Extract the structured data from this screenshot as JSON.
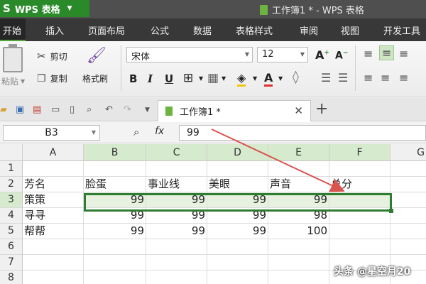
{
  "titlebar": {
    "app_name": "WPS 表格",
    "window_title": "工作簿1 * - WPS 表格"
  },
  "menu": [
    "开始",
    "插入",
    "页面布局",
    "公式",
    "数据",
    "表格样式",
    "审阅",
    "视图",
    "开发工具"
  ],
  "ribbon": {
    "paste": "粘贴",
    "cut": "剪切",
    "copy": "复制",
    "format_painter": "格式刷",
    "font_name": "宋体",
    "font_size": "12",
    "bold": "B",
    "italic": "I",
    "underline": "U"
  },
  "doc_tab": {
    "title": "工作簿1 *"
  },
  "formula_bar": {
    "cell_ref": "B3",
    "fx": "fx",
    "value": "99"
  },
  "columns": [
    "A",
    "B",
    "C",
    "D",
    "E",
    "F",
    "G"
  ],
  "rows": [
    {
      "num": "1",
      "cells": [
        "",
        "",
        "",
        "",
        "",
        ""
      ]
    },
    {
      "num": "2",
      "cells": [
        "芳名",
        "脸蛋",
        "事业线",
        "美眼",
        "声音",
        "总分"
      ]
    },
    {
      "num": "3",
      "cells": [
        "策策",
        "99",
        "99",
        "99",
        "99",
        ""
      ]
    },
    {
      "num": "4",
      "cells": [
        "寻寻",
        "99",
        "99",
        "99",
        "98",
        ""
      ]
    },
    {
      "num": "5",
      "cells": [
        "帮帮",
        "99",
        "99",
        "99",
        "100",
        ""
      ]
    },
    {
      "num": "6",
      "cells": [
        "",
        "",
        "",
        "",
        "",
        ""
      ]
    },
    {
      "num": "7",
      "cells": [
        "",
        "",
        "",
        "",
        "",
        ""
      ]
    },
    {
      "num": "8",
      "cells": [
        "",
        "",
        "",
        "",
        "",
        ""
      ]
    }
  ],
  "watermark": "头条 @星空月20",
  "colors": {
    "menu_bg": "#383838",
    "accent": "#2f7d32",
    "selection_fill": "#e6f2df",
    "arrow": "#d9534f"
  }
}
